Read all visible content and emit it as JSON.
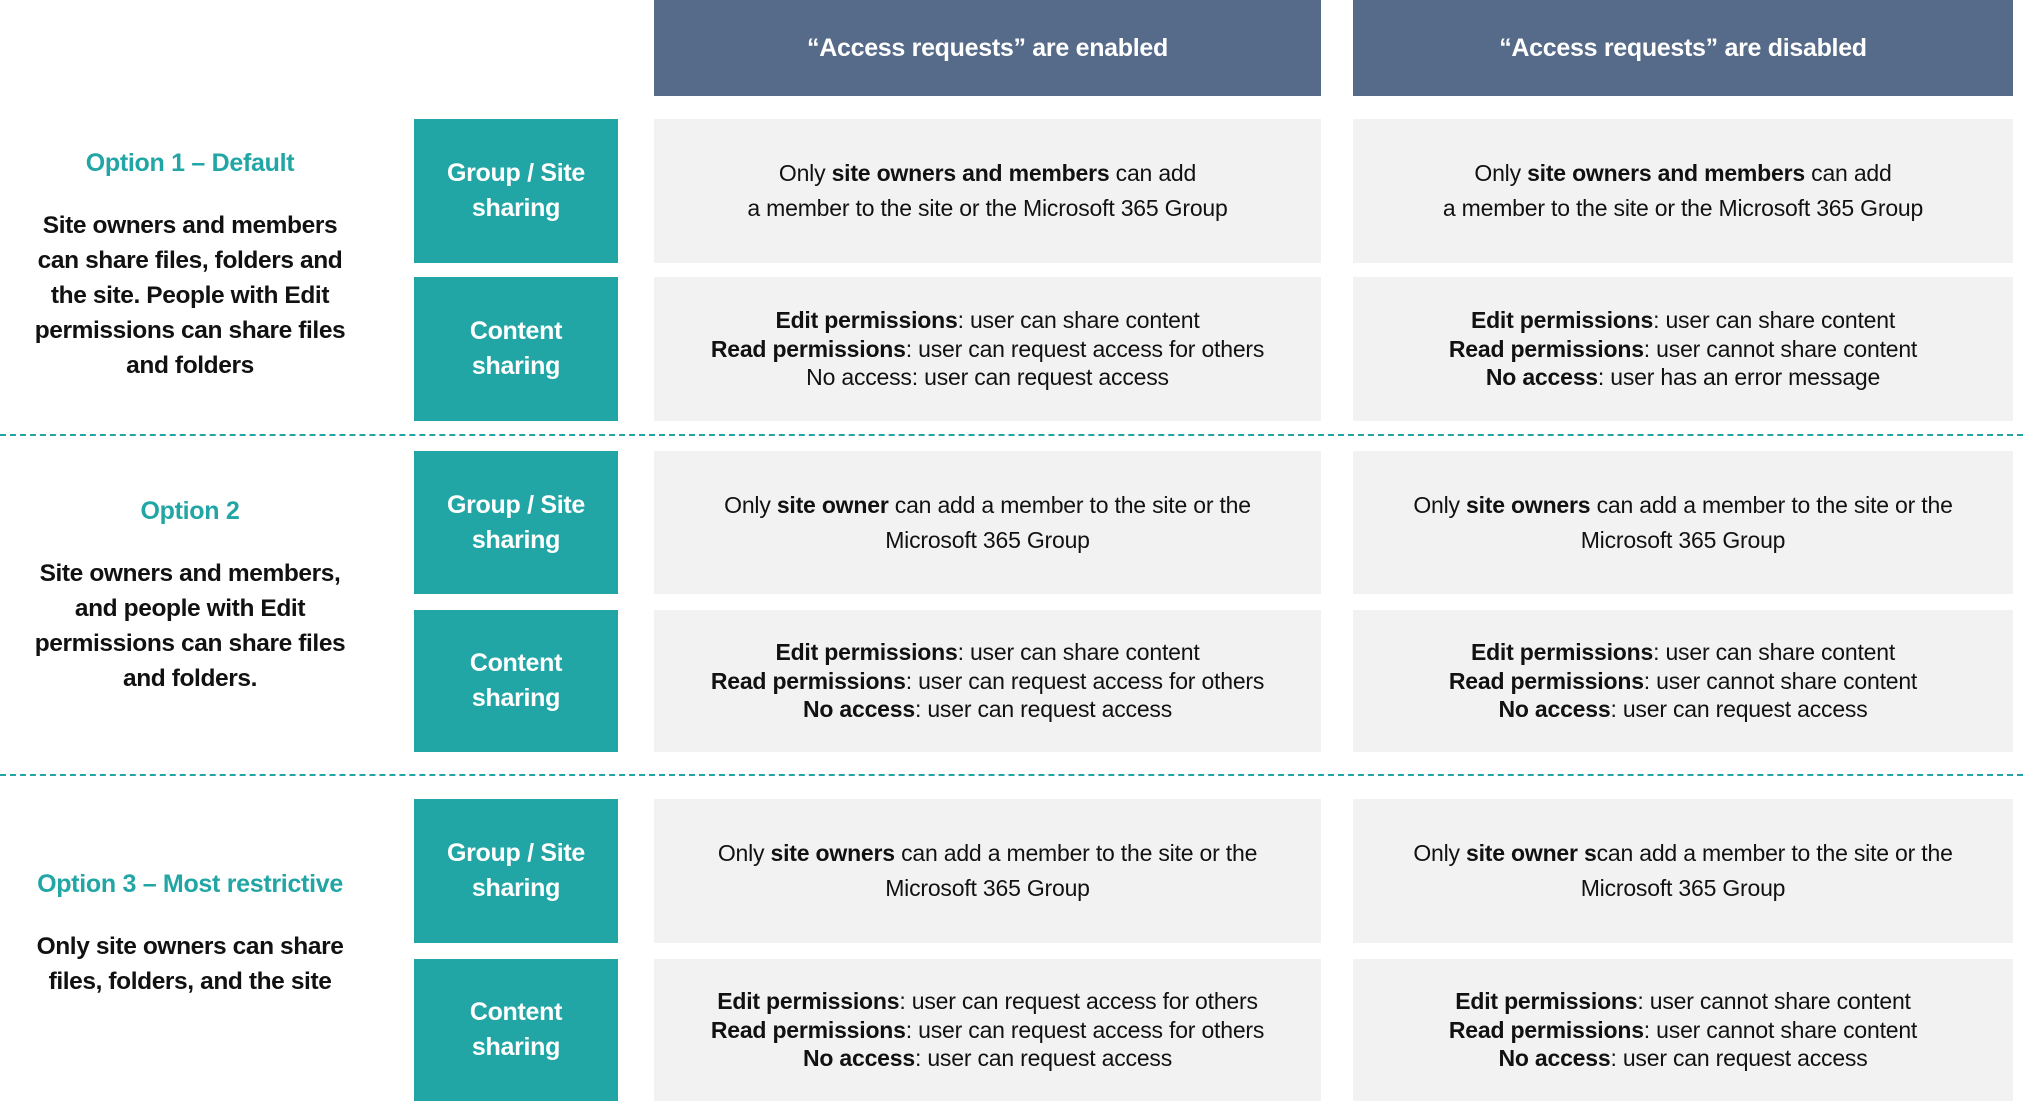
{
  "colors": {
    "header_bg": "#566A89",
    "accent_teal": "#21A6A5",
    "cell_bg": "#F2F2F2",
    "text": "#111111"
  },
  "columns": [
    {
      "label": "“Access requests” are enabled"
    },
    {
      "label": "“Access requests” are disabled"
    }
  ],
  "row_labels": {
    "group": "Group / Site sharing",
    "content": "Content sharing"
  },
  "options": [
    {
      "title": "Option 1 – Default",
      "description": "Site owners and members can share files, folders and the site. People with Edit permissions can share files and folders",
      "group_cells": [
        {
          "segments": [
            {
              "text": "Only ",
              "bold": false
            },
            {
              "text": "site owners and members",
              "bold": true
            },
            {
              "text": " can add",
              "bold": false
            },
            {
              "br": true
            },
            {
              "text": "a member to the site or the Microsoft 365 Group",
              "bold": false
            }
          ]
        },
        {
          "segments": [
            {
              "text": "Only ",
              "bold": false
            },
            {
              "text": "site owners and members",
              "bold": true
            },
            {
              "text": " can add",
              "bold": false
            },
            {
              "br": true
            },
            {
              "text": "a member to the site or the Microsoft 365 Group",
              "bold": false
            }
          ]
        }
      ],
      "content_cells": [
        {
          "lines": [
            {
              "label": "Edit permissions",
              "label_bold": true,
              "text": ": user can share content"
            },
            {
              "label": "Read permissions",
              "label_bold": true,
              "text": ": user can request access for others"
            },
            {
              "label": "No access",
              "label_bold": false,
              "text": ": user can request access"
            }
          ]
        },
        {
          "lines": [
            {
              "label": "Edit permissions",
              "label_bold": true,
              "text": ": user can share content"
            },
            {
              "label": "Read permissions",
              "label_bold": true,
              "text": ": user cannot share content"
            },
            {
              "label": "No access",
              "label_bold": true,
              "text": ": user has an error message"
            }
          ]
        }
      ]
    },
    {
      "title": "Option 2",
      "description": "Site owners and members, and people with Edit permissions can share files and folders.",
      "group_cells": [
        {
          "segments": [
            {
              "text": "Only ",
              "bold": false
            },
            {
              "text": "site owner",
              "bold": true
            },
            {
              "text": " can add a member to the site or the",
              "bold": false
            },
            {
              "br": true
            },
            {
              "text": "Microsoft 365 Group",
              "bold": false
            }
          ]
        },
        {
          "segments": [
            {
              "text": "Only ",
              "bold": false
            },
            {
              "text": "site owners",
              "bold": true
            },
            {
              "text": " can add a member to the site or the",
              "bold": false
            },
            {
              "br": true
            },
            {
              "text": "Microsoft 365 Group",
              "bold": false
            }
          ]
        }
      ],
      "content_cells": [
        {
          "lines": [
            {
              "label": "Edit permissions",
              "label_bold": true,
              "text": ": user can share content"
            },
            {
              "label": "Read permissions",
              "label_bold": true,
              "text": ": user can request access for others"
            },
            {
              "label": "No access",
              "label_bold": true,
              "text": ": user can request access"
            }
          ]
        },
        {
          "lines": [
            {
              "label": "Edit permissions",
              "label_bold": true,
              "text": ": user can share content"
            },
            {
              "label": "Read permissions",
              "label_bold": true,
              "text": ": user cannot share content"
            },
            {
              "label": "No access",
              "label_bold": true,
              "text": ": user can request access"
            }
          ]
        }
      ]
    },
    {
      "title": "Option 3 – Most restrictive",
      "description": "Only site owners can share files, folders, and the site",
      "group_cells": [
        {
          "segments": [
            {
              "text": "Only ",
              "bold": false
            },
            {
              "text": "site owners",
              "bold": true
            },
            {
              "text": " can add a member to the site or the",
              "bold": false
            },
            {
              "br": true
            },
            {
              "text": "Microsoft 365 Group",
              "bold": false
            }
          ]
        },
        {
          "segments": [
            {
              "text": "Only ",
              "bold": false
            },
            {
              "text": "site owner s",
              "bold": true
            },
            {
              "text": "can add a member to the site or the",
              "bold": false
            },
            {
              "br": true
            },
            {
              "text": "Microsoft 365 Group",
              "bold": false
            }
          ]
        }
      ],
      "content_cells": [
        {
          "lines": [
            {
              "label": "Edit permissions",
              "label_bold": true,
              "text": ": user can request access for others"
            },
            {
              "label": "Read permissions",
              "label_bold": true,
              "text": ": user can request access for others"
            },
            {
              "label": "No access",
              "label_bold": true,
              "text": ": user can request access"
            }
          ]
        },
        {
          "lines": [
            {
              "label": "Edit permissions",
              "label_bold": true,
              "text": ": user cannot share content"
            },
            {
              "label": "Read permissions",
              "label_bold": true,
              "text": ": user cannot share content"
            },
            {
              "label": "No access",
              "label_bold": true,
              "text": ": user can request access"
            }
          ]
        }
      ]
    }
  ]
}
